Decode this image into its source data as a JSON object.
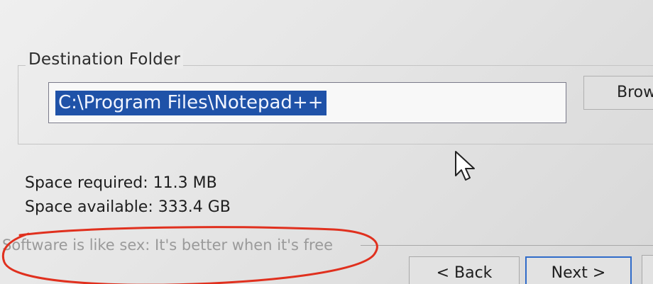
{
  "destination": {
    "group_label": "Destination Folder",
    "path_value": "C:\\Program Files\\Notepad++",
    "browse_label": "Brow"
  },
  "space": {
    "required": "Space required: 11.3 MB",
    "available": "Space available: 333.4 GB"
  },
  "branding_text": "Software is like sex: It's better when it's free",
  "buttons": {
    "back": "< Back",
    "next": "Next >"
  },
  "colors": {
    "selection_bg": "#1f52a8",
    "annotation_red": "#e0301e",
    "default_button_border": "#2f6bc9"
  },
  "icons": {
    "cursor": "arrow-cursor-icon"
  }
}
